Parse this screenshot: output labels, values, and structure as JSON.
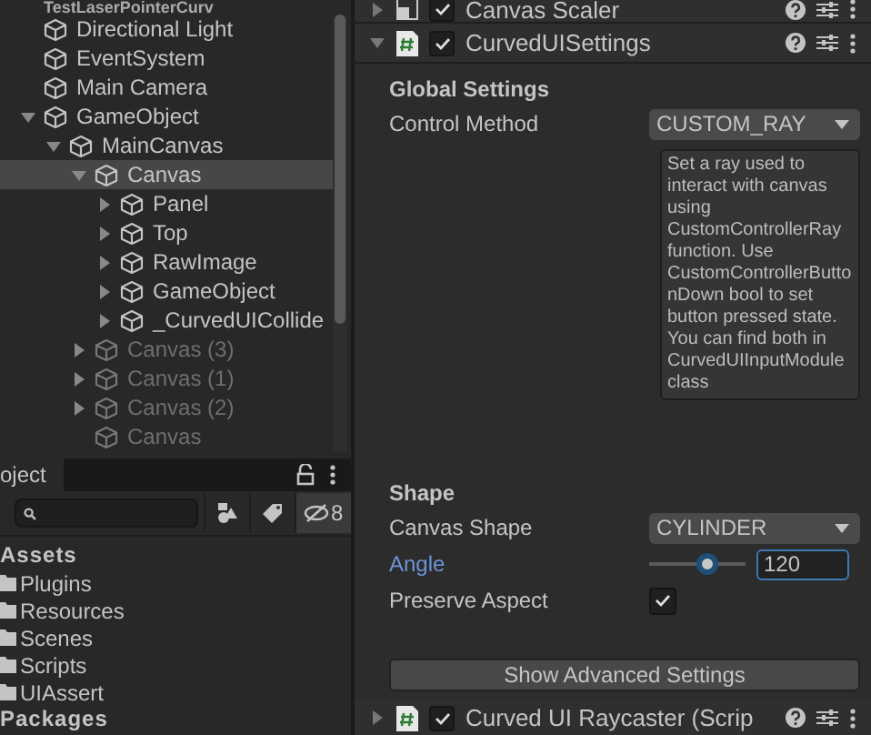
{
  "hierarchy": {
    "scene": "TestLaserPointerCurv",
    "items": [
      {
        "label": "Directional Light",
        "active": true,
        "selected": false
      },
      {
        "label": "EventSystem",
        "active": true,
        "selected": false
      },
      {
        "label": "Main Camera",
        "active": true,
        "selected": false
      },
      {
        "label": "GameObject",
        "active": true,
        "selected": false,
        "expanded": true,
        "children": [
          {
            "label": "MainCanvas",
            "active": true,
            "selected": false,
            "expanded": true,
            "children": [
              {
                "label": "Canvas",
                "active": true,
                "selected": true,
                "expanded": true,
                "children": [
                  {
                    "label": "Panel",
                    "active": true,
                    "selected": false,
                    "expanded": false
                  },
                  {
                    "label": "Top",
                    "active": true,
                    "selected": false,
                    "expanded": false
                  },
                  {
                    "label": "RawImage",
                    "active": true,
                    "selected": false,
                    "expanded": false
                  },
                  {
                    "label": "GameObject",
                    "active": true,
                    "selected": false,
                    "expanded": false
                  },
                  {
                    "label": "_CurvedUICollide",
                    "active": true,
                    "selected": false,
                    "expanded": false
                  }
                ]
              },
              {
                "label": "Canvas (3)",
                "active": false,
                "selected": false,
                "expanded": false
              },
              {
                "label": "Canvas (1)",
                "active": false,
                "selected": false,
                "expanded": false
              },
              {
                "label": "Canvas (2)",
                "active": false,
                "selected": false,
                "expanded": false
              },
              {
                "label": "Canvas",
                "active": false,
                "selected": false
              }
            ]
          }
        ]
      }
    ]
  },
  "project": {
    "tab": "oject",
    "hidden_count": "8",
    "section": "Assets",
    "folders": [
      "Plugins",
      "Resources",
      "Scenes",
      "Scripts",
      "UIAssert"
    ],
    "next_section": "Packages"
  },
  "inspector": {
    "components": [
      {
        "title": "Canvas Scaler",
        "kind": "scaler",
        "enabled": true,
        "expanded": false
      },
      {
        "title": "CurvedUISettings",
        "kind": "script",
        "enabled": true,
        "expanded": true
      }
    ],
    "global_heading": "Global Settings",
    "control_method": {
      "label": "Control Method",
      "value": "CUSTOM_RAY"
    },
    "help": "Set a ray used to interact with canvas using CustomControllerRay function. Use CustomControllerButtonDown bool to set button pressed state.\nYou can find both in CurvedUIInputModule class",
    "shape_heading": "Shape",
    "canvas_shape": {
      "label": "Canvas Shape",
      "value": "CYLINDER"
    },
    "angle": {
      "label": "Angle",
      "level": 0.6,
      "value": "120",
      "focused": true
    },
    "preserve_aspect": {
      "label": "Preserve Aspect",
      "checked": true
    },
    "advanced_button": "Show Advanced Settings",
    "next_component": {
      "title": "Curved UI Raycaster (Scrip",
      "kind": "script",
      "enabled": true,
      "expanded": false
    }
  }
}
